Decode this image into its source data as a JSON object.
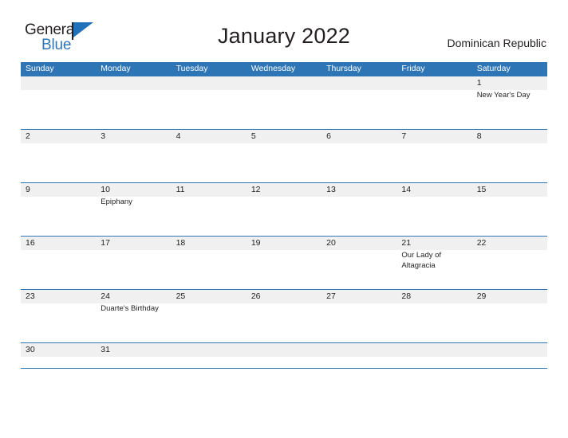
{
  "brand": {
    "name_part1": "General",
    "name_part2": "Blue",
    "flag_icon": "blue-flag-triangle-icon",
    "color_dark": "#231f20",
    "color_blue": "#2e75b6"
  },
  "header": {
    "title": "January 2022",
    "country": "Dominican Republic",
    "accent_color": "#2e75b6",
    "daynum_band_color": "#f0f0f0"
  },
  "calendar": {
    "month": "January",
    "year": "2022",
    "weekdays": [
      "Sunday",
      "Monday",
      "Tuesday",
      "Wednesday",
      "Thursday",
      "Friday",
      "Saturday"
    ],
    "weeks": [
      [
        {
          "day": "",
          "event": ""
        },
        {
          "day": "",
          "event": ""
        },
        {
          "day": "",
          "event": ""
        },
        {
          "day": "",
          "event": ""
        },
        {
          "day": "",
          "event": ""
        },
        {
          "day": "",
          "event": ""
        },
        {
          "day": "1",
          "event": "New Year's Day"
        }
      ],
      [
        {
          "day": "2",
          "event": ""
        },
        {
          "day": "3",
          "event": ""
        },
        {
          "day": "4",
          "event": ""
        },
        {
          "day": "5",
          "event": ""
        },
        {
          "day": "6",
          "event": ""
        },
        {
          "day": "7",
          "event": ""
        },
        {
          "day": "8",
          "event": ""
        }
      ],
      [
        {
          "day": "9",
          "event": ""
        },
        {
          "day": "10",
          "event": "Epiphany"
        },
        {
          "day": "11",
          "event": ""
        },
        {
          "day": "12",
          "event": ""
        },
        {
          "day": "13",
          "event": ""
        },
        {
          "day": "14",
          "event": ""
        },
        {
          "day": "15",
          "event": ""
        }
      ],
      [
        {
          "day": "16",
          "event": ""
        },
        {
          "day": "17",
          "event": ""
        },
        {
          "day": "18",
          "event": ""
        },
        {
          "day": "19",
          "event": ""
        },
        {
          "day": "20",
          "event": ""
        },
        {
          "day": "21",
          "event": "Our Lady of Altagracia"
        },
        {
          "day": "22",
          "event": ""
        }
      ],
      [
        {
          "day": "23",
          "event": ""
        },
        {
          "day": "24",
          "event": "Duarte's Birthday"
        },
        {
          "day": "25",
          "event": ""
        },
        {
          "day": "26",
          "event": ""
        },
        {
          "day": "27",
          "event": ""
        },
        {
          "day": "28",
          "event": ""
        },
        {
          "day": "29",
          "event": ""
        }
      ],
      [
        {
          "day": "30",
          "event": ""
        },
        {
          "day": "31",
          "event": ""
        },
        {
          "day": "",
          "event": ""
        },
        {
          "day": "",
          "event": ""
        },
        {
          "day": "",
          "event": ""
        },
        {
          "day": "",
          "event": ""
        },
        {
          "day": "",
          "event": ""
        }
      ]
    ]
  }
}
